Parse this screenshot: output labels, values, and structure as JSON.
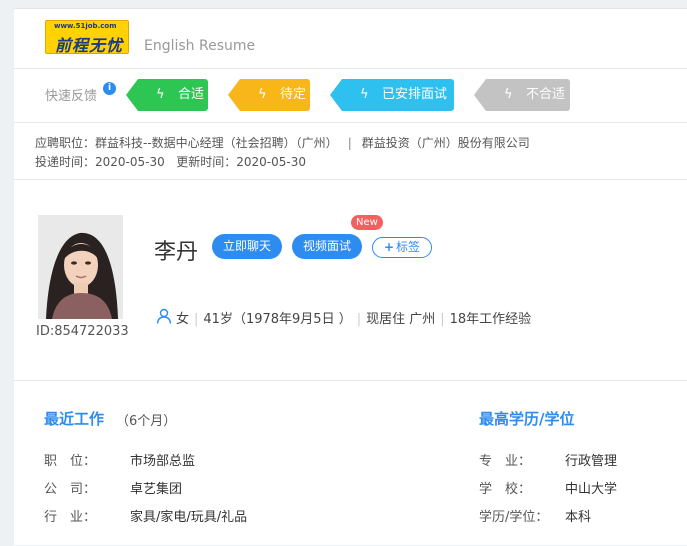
{
  "header": {
    "logo_url": "www.51job.com",
    "logo_text": "前程无忧",
    "english_resume": "English Resume"
  },
  "feedback": {
    "label": "快速反馈",
    "info": "i",
    "buttons": [
      {
        "label": "合适",
        "color": "#2dc653"
      },
      {
        "label": "待定",
        "color": "#f8b61b"
      },
      {
        "label": "已安排面试",
        "color": "#2ec0ef"
      },
      {
        "label": "不合适",
        "color": "#c3c3c3"
      }
    ]
  },
  "job": {
    "applied_label": "应聘职位：",
    "applied_value": "群益科技--数据中心经理（社会招聘）（广州）",
    "separator": "|",
    "company": "群益投资（广州）股份有限公司",
    "delivered_label": "投递时间：",
    "delivered_value": "2020-05-30",
    "updated_label": "更新时间：",
    "updated_value": "2020-05-30"
  },
  "profile": {
    "name": "李丹",
    "chat_label": "立即聊天",
    "video_label": "视频面试",
    "new_badge": "New",
    "tag_plus": "+",
    "tag_label": "标签",
    "id": "ID:854722033",
    "gender": "女",
    "age": "41岁（1978年9月5日 ）",
    "residence": "现居住 广州",
    "experience": "18年工作经验"
  },
  "recent_work": {
    "title": "最近工作",
    "duration": "（6个月）",
    "rows": [
      {
        "label": "职　位：",
        "value": "市场部总监"
      },
      {
        "label": "公　司：",
        "value": "卓艺集团"
      },
      {
        "label": "行　业：",
        "value": "家具/家电/玩具/礼品"
      }
    ]
  },
  "education": {
    "title": "最高学历/学位",
    "rows": [
      {
        "label": "专　业：",
        "value": "行政管理"
      },
      {
        "label": "学　校：",
        "value": "中山大学"
      },
      {
        "label": "学历/学位：",
        "value": "本科"
      }
    ]
  }
}
